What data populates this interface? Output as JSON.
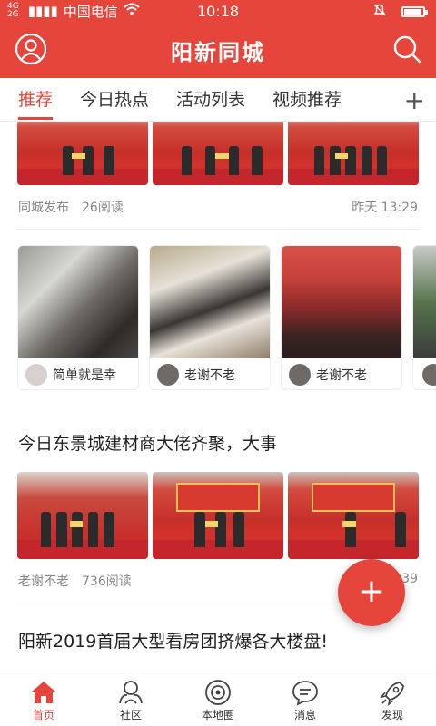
{
  "status": {
    "carrier": "中国电信",
    "network": "4G",
    "network2": "2G",
    "time": "10:18",
    "battery_level": 0.85
  },
  "app": {
    "title": "阳新同城",
    "accent": "#e5453a"
  },
  "header": {
    "left_icon": "user-icon",
    "right_icon": "search-icon"
  },
  "tabs": [
    {
      "label": "推荐",
      "active": true
    },
    {
      "label": "今日热点",
      "active": false
    },
    {
      "label": "活动列表",
      "active": false
    },
    {
      "label": "视频推荐",
      "active": false
    }
  ],
  "tab_add_label": "+",
  "feed": {
    "post1": {
      "author": "同城发布",
      "reads": "26阅读",
      "time": "昨天 13:29"
    },
    "video_cards": [
      {
        "user": "简单就是幸"
      },
      {
        "user": "老谢不老"
      },
      {
        "user": "老谢不老"
      }
    ],
    "post2": {
      "title": "今日东景城建材商大佬齐聚，大事",
      "author": "老谢不老",
      "reads": "736阅读",
      "time_partial": "39"
    },
    "post3": {
      "title": "阳新2019首届大型看房团挤爆各大楼盘!"
    }
  },
  "fab_label": "+",
  "bottom_nav": [
    {
      "label": "首页",
      "icon": "home-icon",
      "active": true
    },
    {
      "label": "社区",
      "icon": "community-icon",
      "active": false
    },
    {
      "label": "本地圈",
      "icon": "local-circle-icon",
      "active": false
    },
    {
      "label": "消息",
      "icon": "message-icon",
      "active": false
    },
    {
      "label": "发现",
      "icon": "discover-icon",
      "active": false
    }
  ]
}
